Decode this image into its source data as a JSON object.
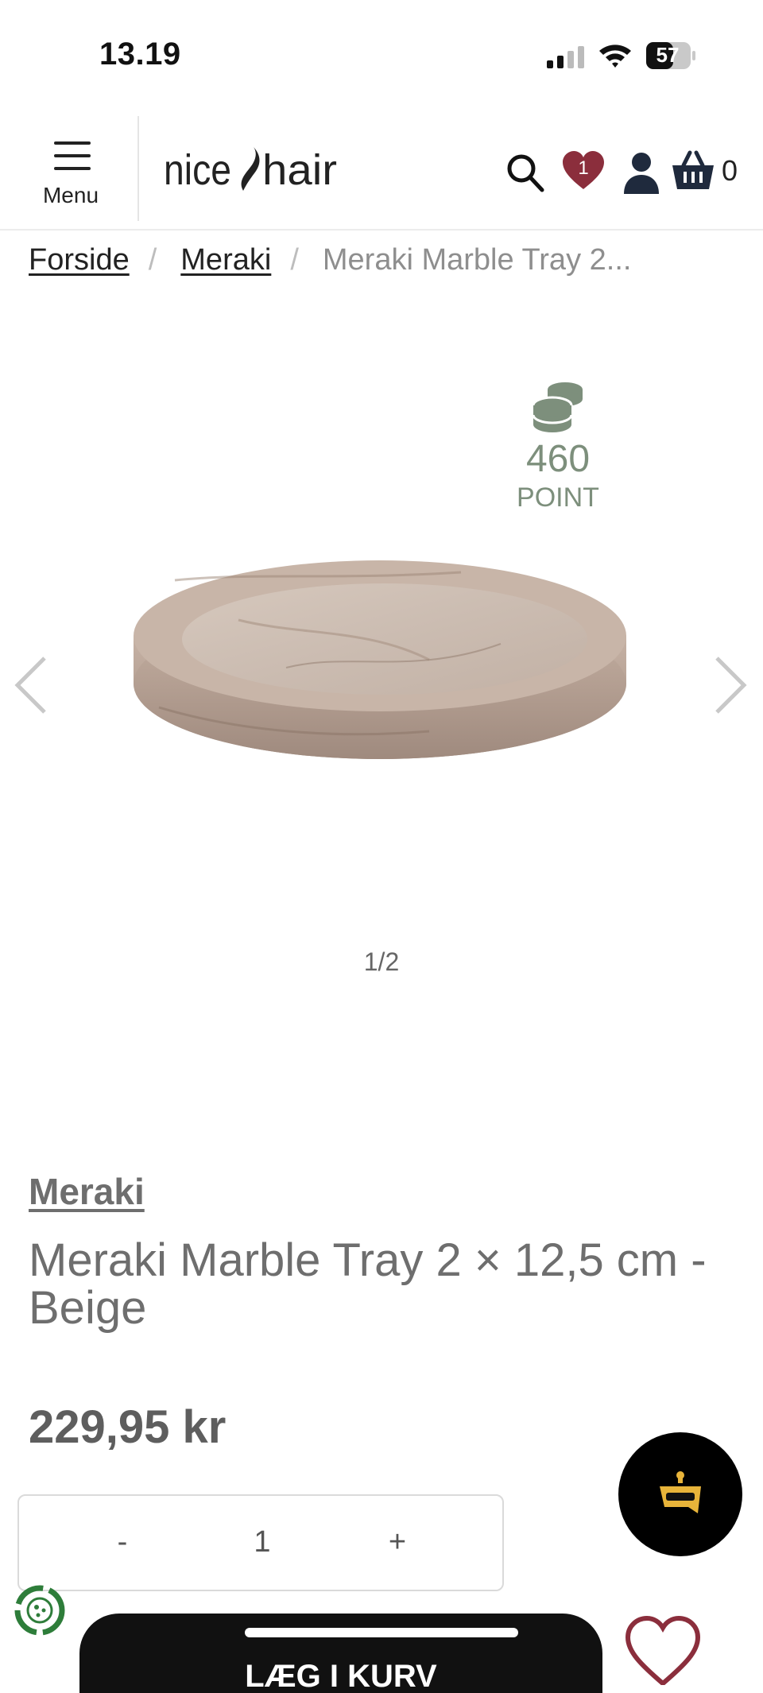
{
  "status_bar": {
    "time": "13.19",
    "battery": "57"
  },
  "header": {
    "menu_label": "Menu",
    "logo_text": "nice hair",
    "wishlist_count": "1",
    "cart_count": "0"
  },
  "breadcrumb": {
    "home": "Forside",
    "separator": "/",
    "brand": "Meraki",
    "current": "Meraki Marble Tray 2..."
  },
  "gallery": {
    "points_value": "460",
    "points_label": "POINT",
    "counter": "1/2"
  },
  "product": {
    "brand": "Meraki",
    "title": "Meraki Marble Tray 2 × 12,5 cm - Beige",
    "price": "229,95 kr"
  },
  "quantity": {
    "minus": "-",
    "value": "1",
    "plus": "+"
  },
  "cta": {
    "add_to_cart": "LÆG I KURV"
  },
  "colors": {
    "wishlist": "#8b2e3c",
    "points": "#7d8f7c",
    "recycle": "#2e7d3a"
  }
}
